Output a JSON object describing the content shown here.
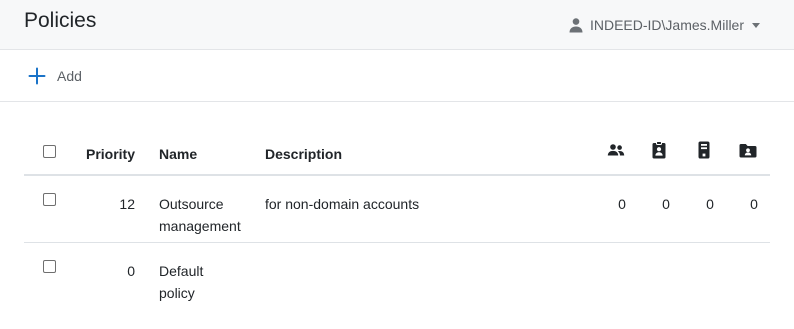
{
  "header": {
    "title": "Policies",
    "user": "INDEED-ID\\James.Miller",
    "user_icon": "person-icon"
  },
  "toolbar": {
    "add_label": "Add"
  },
  "table": {
    "columns": {
      "priority": "Priority",
      "name": "Name",
      "description": "Description"
    },
    "count_icons": [
      "users-icon",
      "id-badge-icon",
      "device-icon",
      "folder-user-icon"
    ],
    "rows": [
      {
        "priority": "12",
        "name": "Outsource management",
        "description": "for non-domain accounts",
        "counts": [
          "0",
          "0",
          "0",
          "0"
        ]
      },
      {
        "priority": "0",
        "name": "Default policy",
        "description": "",
        "counts": [
          "",
          "",
          "",
          ""
        ]
      }
    ]
  },
  "colors": {
    "accent": "#0d6efd",
    "header_bg": "#f7f8f9",
    "border": "#dee2e6"
  }
}
